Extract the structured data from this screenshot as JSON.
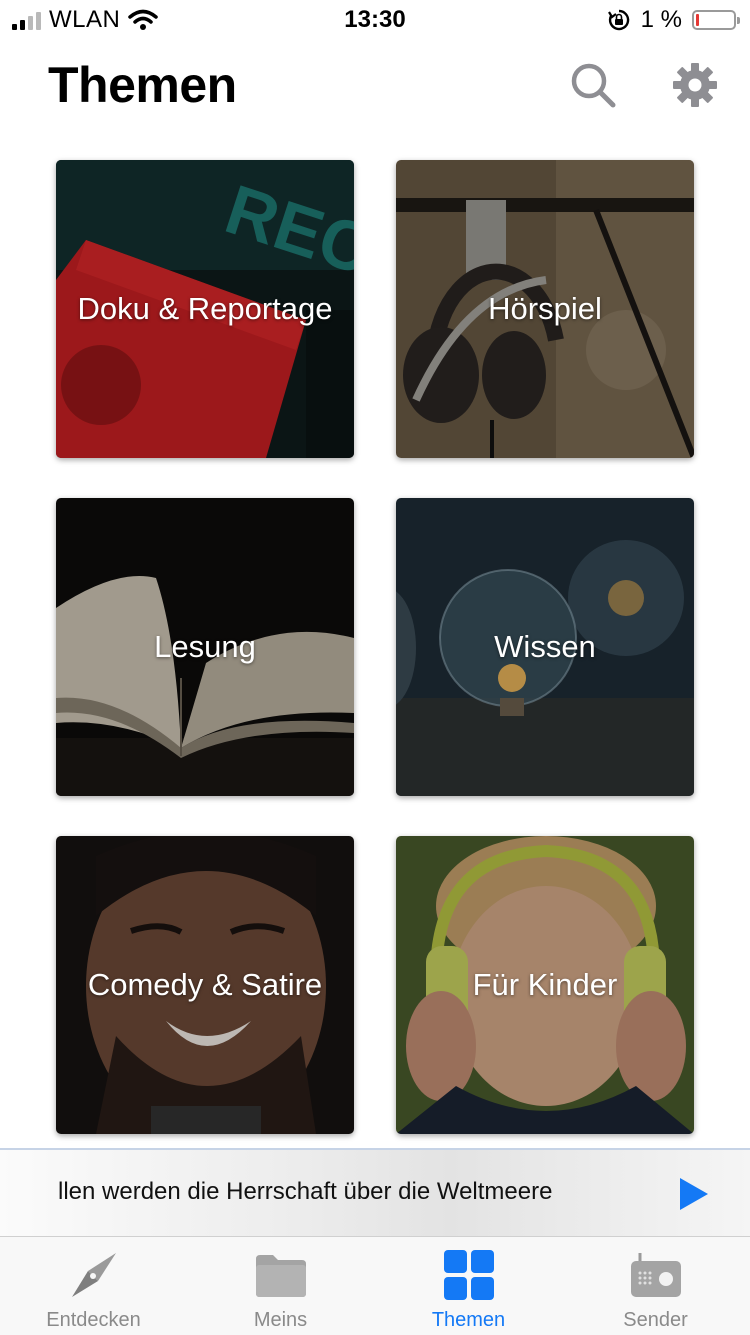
{
  "status_bar": {
    "carrier": "WLAN",
    "time": "13:30",
    "battery": "1 %"
  },
  "header": {
    "title": "Themen"
  },
  "tiles": [
    {
      "label": "Doku & Reportage"
    },
    {
      "label": "Hörspiel"
    },
    {
      "label": "Lesung"
    },
    {
      "label": "Wissen"
    },
    {
      "label": "Comedy & Satire"
    },
    {
      "label": "Für Kinder"
    }
  ],
  "mini_player": {
    "text": "llen werden die Herrschaft über die Weltmeere"
  },
  "tab_bar": {
    "tabs": [
      {
        "label": "Entdecken",
        "icon": "compass-icon"
      },
      {
        "label": "Meins",
        "icon": "folder-icon"
      },
      {
        "label": "Themen",
        "icon": "grid-icon",
        "active": true
      },
      {
        "label": "Sender",
        "icon": "radio-icon"
      }
    ]
  },
  "colors": {
    "accent": "#1479f5",
    "inactive": "#8a8a8a"
  }
}
